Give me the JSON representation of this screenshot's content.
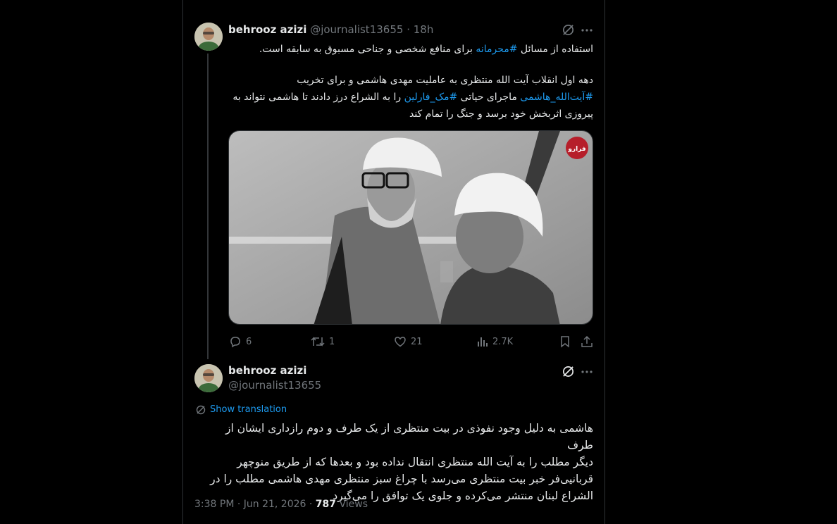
{
  "post1": {
    "name": "behrooz azizi",
    "handle": "@journalist13655",
    "dot": "·",
    "time": "18h",
    "line1_pre": "استفاده از مسائل ",
    "line1_tag": "#محرمانه",
    "line1_post": " برای منافع شخصی و جناحی مسبوق به سابقه است.",
    "line2": "دهه اول انقلاب آیت الله منتظری به عاملیت مهدی هاشمی و برای تخریب",
    "line3_tag1": "#آیت‌الله_هاشمی",
    "line3_mid": " ماجرای حیاتی ",
    "line3_tag2": "#مک_فارلین",
    "line3_post": " را به الشراع درز دادند تا هاشمی نتواند به",
    "line4": "پیروزی اثربخش خود برسد و جنگ را تمام کند",
    "watermark": "فرارو",
    "actions": {
      "replies": "6",
      "reposts": "1",
      "likes": "21",
      "views": "2.7K"
    }
  },
  "post2": {
    "name": "behrooz azizi",
    "handle": "@journalist13655",
    "show_translation": "Show translation",
    "lines": [
      "هاشمی به دلیل وجود نفوذی در بیت منتظری از یک طرف و دوم رازداری ایشان از طرف",
      "دیگر مطلب را به آیت الله منتظری انتقال نداده بود و بعدها که از طریق منوچهر",
      "قربانیی‌فر خبر بیت منتظری می‌رسد با چراغ سبز منتظری مهدی هاشمی مطلب را در",
      "الشراع لبنان منتشر می‌کرده و جلوی یک توافق را می‌گیرد"
    ],
    "timestamp": "3:38 PM · Jun 21, 2026 · ",
    "views_count": "787",
    "views_label": " Views"
  },
  "colors": {
    "background": "#000000",
    "text": "#e7e9ea",
    "muted": "#71767b",
    "link": "#1d9bf0",
    "border": "#2f3336"
  },
  "icons": [
    "grok-icon",
    "more-icon",
    "reply-icon",
    "repost-icon",
    "like-icon",
    "views-icon",
    "bookmark-icon",
    "share-icon",
    "translate-icon"
  ]
}
